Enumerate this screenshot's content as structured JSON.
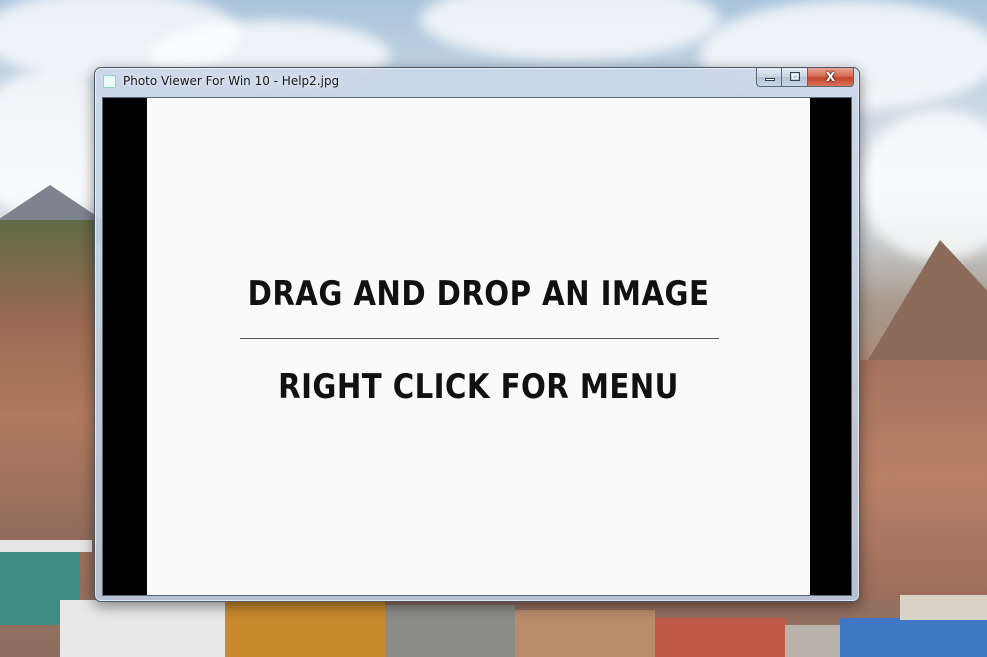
{
  "window": {
    "title": "Photo Viewer For Win 10 - Help2.jpg",
    "app_icon": "app-icon",
    "buttons": {
      "minimize_icon": "minimize-icon",
      "maximize_icon": "maximize-icon",
      "close_icon": "close-icon",
      "close_glyph": "X"
    }
  },
  "help_image": {
    "line1": "DRAG AND DROP AN IMAGE",
    "line2": "RIGHT CLICK FOR MENU"
  },
  "colors": {
    "close_button": "#c2442a",
    "canvas": "#fafafa",
    "letterbox": "#000000"
  }
}
